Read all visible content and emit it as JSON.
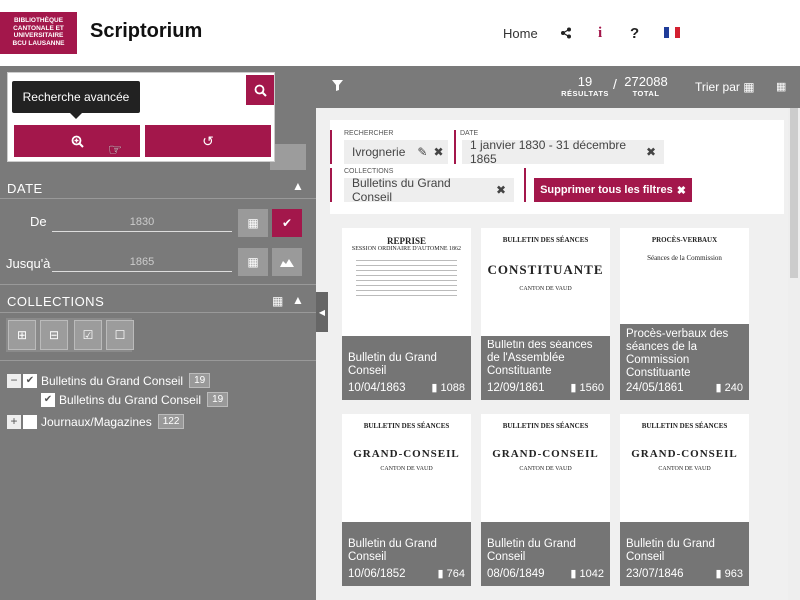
{
  "header": {
    "logo_lines": [
      "BIBLIOTHÈQUE",
      "CANTONALE ET",
      "UNIVERSITAIRE",
      "BCU LAUSANNE"
    ],
    "brand": "Scriptorium",
    "nav": {
      "home": "Home",
      "share_icon": "share-icon",
      "info": "i",
      "help": "?",
      "lang": "FR"
    }
  },
  "search_popup": {
    "tooltip": "Recherche avancée",
    "search_icon": "search-icon",
    "advanced_icon": "zoom-in-icon",
    "reset_icon": "reset-icon"
  },
  "sidebar": {
    "date": {
      "title": "DATE",
      "from_label": "De",
      "from_value": "1830",
      "to_label": "Jusqu'à",
      "to_value": "1865"
    },
    "collections": {
      "title": "COLLECTIONS",
      "items": [
        {
          "label": "Bulletins du Grand Conseil",
          "count": "19",
          "checked": true,
          "expanded": true
        },
        {
          "label": "Bulletins du Grand Conseil",
          "count": "19",
          "checked": true,
          "child": true
        },
        {
          "label": "Journaux/Magazines",
          "count": "122",
          "checked": false,
          "expanded": false
        }
      ]
    }
  },
  "results_bar": {
    "results_count": "19",
    "results_label": "RÉSULTATS",
    "separator": "/",
    "total_count": "272088",
    "total_label": "TOTAL",
    "sort_label": "Trier par"
  },
  "filters": {
    "search": {
      "label": "RECHERCHER",
      "value": "Ivrognerie"
    },
    "date": {
      "label": "DATE",
      "value": "1 janvier 1830 - 31 décembre 1865"
    },
    "collections": {
      "label": "COLLECTIONS",
      "value": "Bulletins du Grand Conseil"
    },
    "clear_all": "Supprimer tous les filtres"
  },
  "cards": [
    {
      "title": "Bulletin du Grand Conseil",
      "date": "10/04/1863",
      "pages": "1088",
      "scan_head": "REPRISE",
      "scan_main": "",
      "scan_sub": "SESSION ORDINAIRE D'AUTOMNE 1862"
    },
    {
      "title": "Bulletin des séances de l'Assemblée Constituante",
      "date": "12/09/1861",
      "pages": "1560",
      "scan_head": "BULLETIN DES SÉANCES",
      "scan_main": "CONSTITUANTE",
      "scan_sub": "CANTON DE VAUD"
    },
    {
      "title": "Procès-verbaux des séances de la Commission Constituante",
      "date": "24/05/1861",
      "pages": "240",
      "scan_head": "PROCÈS-VERBAUX",
      "scan_main": "",
      "scan_sub": "Séances de la Commission"
    },
    {
      "title": "Bulletin du Grand Conseil",
      "date": "10/06/1852",
      "pages": "764",
      "scan_head": "BULLETIN DES SÉANCES",
      "scan_main": "GRAND-CONSEIL",
      "scan_sub": "CANTON DE VAUD"
    },
    {
      "title": "Bulletin du Grand Conseil",
      "date": "08/06/1849",
      "pages": "1042",
      "scan_head": "BULLETIN DES SÉANCES",
      "scan_main": "GRAND-CONSEIL",
      "scan_sub": "CANTON DE VAUD"
    },
    {
      "title": "Bulletin du Grand Conseil",
      "date": "23/07/1846",
      "pages": "963",
      "scan_head": "BULLETIN DES SÉANCES",
      "scan_main": "GRAND-CONSEIL",
      "scan_sub": "CANTON DE VAUD"
    }
  ],
  "colors": {
    "accent": "#a3174b",
    "sidebar": "#7a7a7a",
    "panel": "#f0f0f0"
  }
}
